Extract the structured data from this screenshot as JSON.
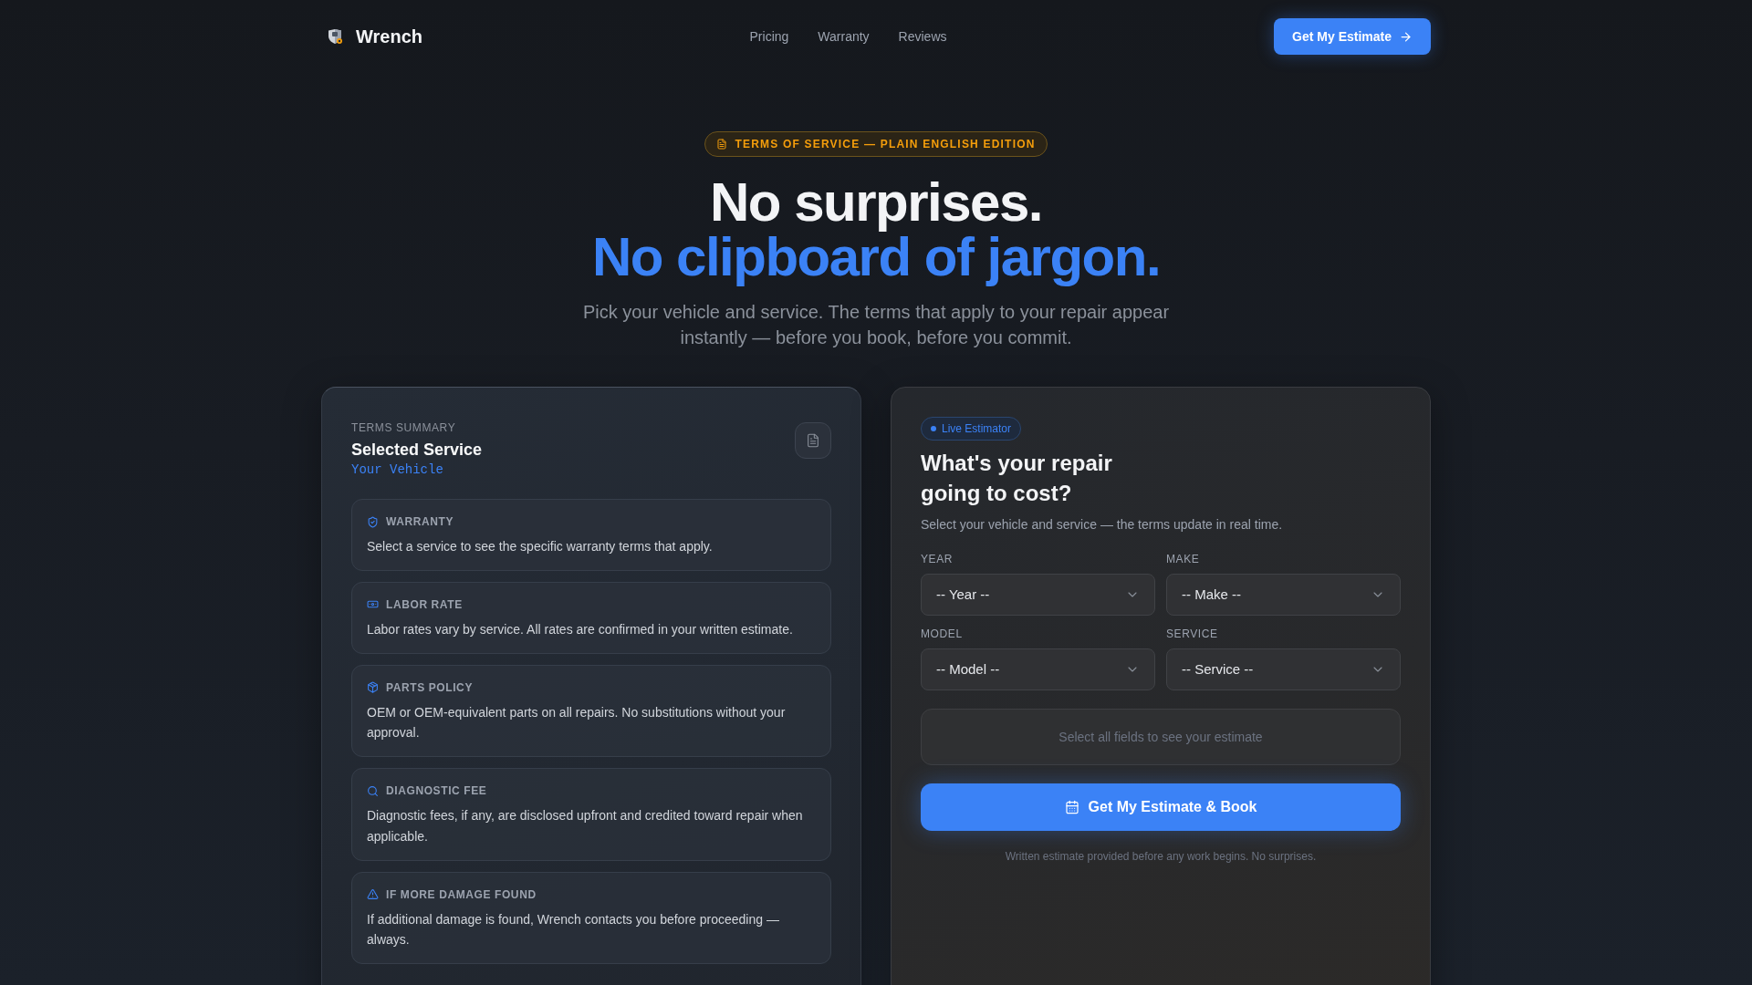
{
  "nav": {
    "brand": "Wrench",
    "links": [
      {
        "label": "Pricing"
      },
      {
        "label": "Warranty"
      },
      {
        "label": "Reviews"
      }
    ],
    "cta": "Get My Estimate"
  },
  "hero": {
    "badge": "TERMS OF SERVICE — PLAIN ENGLISH EDITION",
    "title_line_1": "No surprises.",
    "title_line_2": "No clipboard of jargon.",
    "subtitle": "Pick your vehicle and service. The terms that apply to your repair appear instantly — before you book, before you commit."
  },
  "terms_summary": {
    "eyebrow": "TERMS SUMMARY",
    "title": "Selected Service",
    "vehicle": "Your Vehicle",
    "items": [
      {
        "kind": "warranty",
        "title": "WARRANTY",
        "text": "Select a service to see the specific warranty terms that apply."
      },
      {
        "kind": "labor",
        "title": "LABOR RATE",
        "text": "Labor rates vary by service. All rates are confirmed in your written estimate."
      },
      {
        "kind": "parts",
        "title": "PARTS POLICY",
        "text": "OEM or OEM-equivalent parts on all repairs. No substitutions without your approval."
      },
      {
        "kind": "diagnostic",
        "title": "DIAGNOSTIC FEE",
        "text": "Diagnostic fees, if any, are disclosed upfront and credited toward repair when applicable."
      },
      {
        "kind": "damage",
        "title": "IF MORE DAMAGE FOUND",
        "text": "If additional damage is found, Wrench contacts you before proceeding — always."
      }
    ]
  },
  "estimator": {
    "badge": "Live Estimator",
    "title": "What's your repair going to cost?",
    "subtitle": "Select your vehicle and service — the terms update in real time.",
    "fields": [
      {
        "label": "YEAR",
        "value": "-- Year --"
      },
      {
        "label": "MAKE",
        "value": "-- Make --"
      },
      {
        "label": "MODEL",
        "value": "-- Model --"
      },
      {
        "label": "SERVICE",
        "value": "-- Service --"
      }
    ],
    "result_placeholder": "Select all fields to see your estimate",
    "submit": "Get My Estimate & Book",
    "note": "Written estimate provided before any work begins. No surprises."
  }
}
